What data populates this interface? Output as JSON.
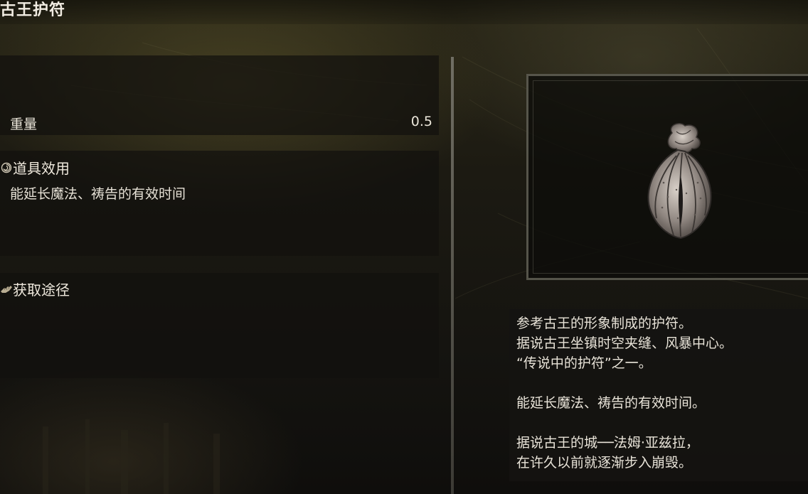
{
  "item": {
    "name": "古王护符"
  },
  "stats": {
    "weight_label": "重量",
    "weight_value": "0.5"
  },
  "effect": {
    "heading": "道具效用",
    "icon": "swirl-icon",
    "text": "能延长魔法、祷告的有效时间"
  },
  "source": {
    "heading": "获取途径",
    "icon": "hand-icon"
  },
  "image": {
    "icon": "talisman-icon"
  },
  "description": {
    "lines": [
      "参考古王的形象制成的护符。",
      "据说古王坐镇时空夹缝、风暴中心。",
      "“传说中的护符”之一。",
      "",
      "能延长魔法、祷告的有效时间。",
      "",
      "据说古王的城──法姆·亚兹拉，",
      "在许久以前就逐渐步入崩毁。"
    ]
  },
  "colors": {
    "text": "#e6e1d6",
    "panel": "#12110e",
    "frame": "#6e6c60"
  }
}
